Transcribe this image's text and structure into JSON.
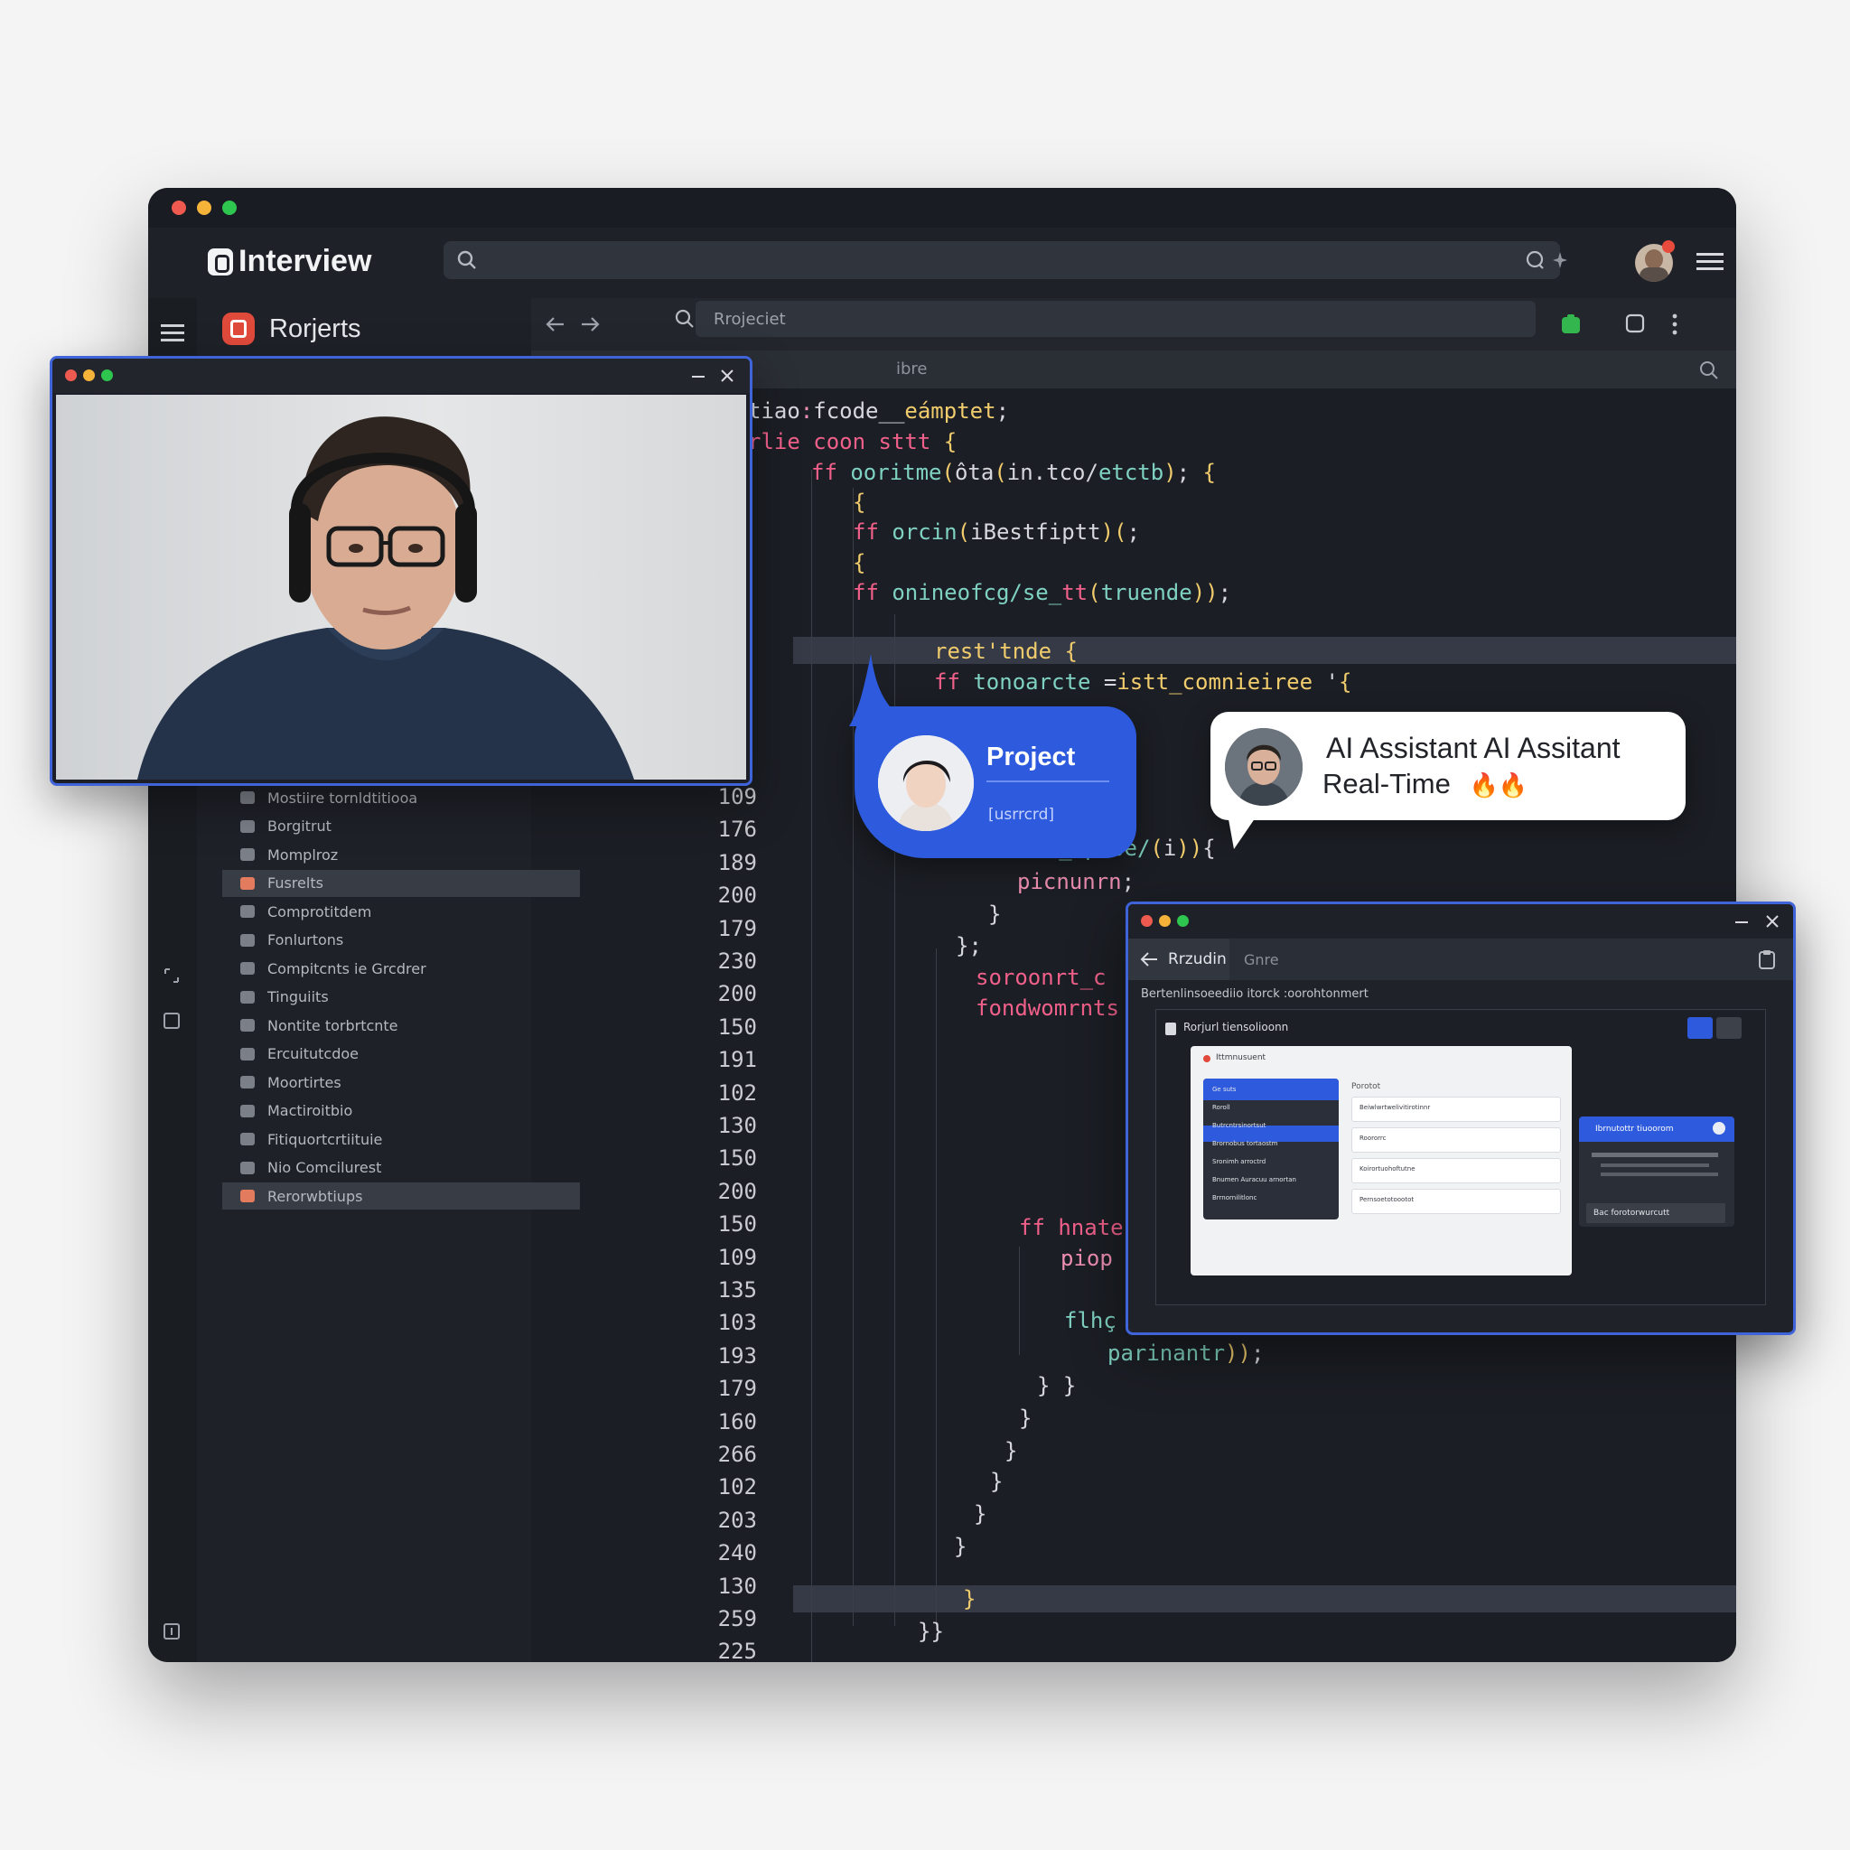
{
  "app": {
    "title": "Interview",
    "project_title": "Rorjerts"
  },
  "nav": {
    "url": "Rrojeciet",
    "subtab": "ibre"
  },
  "sidebar": {
    "items": [
      {
        "label": "Mostiire tornldtitiooa",
        "active": false
      },
      {
        "label": "Borgitrut",
        "active": false
      },
      {
        "label": "Momplroz",
        "active": false
      },
      {
        "label": "Fusrelts",
        "active": true
      },
      {
        "label": "Comprotitdem",
        "active": false
      },
      {
        "label": "Fonlurtons",
        "active": false
      },
      {
        "label": "Compitcnts ie Grcdrer",
        "active": false
      },
      {
        "label": "Tinguiits",
        "active": false
      },
      {
        "label": "Nontite torbrtcnte",
        "active": false
      },
      {
        "label": "Ercuitutcdoe",
        "active": false
      },
      {
        "label": "Moortirtes",
        "active": false
      },
      {
        "label": "Mactiroitbio",
        "active": false
      },
      {
        "label": "Fitiquortcrtiituie",
        "active": false
      },
      {
        "label": "Nio Comcilurest",
        "active": false
      },
      {
        "label": "Rerorwbtiups",
        "active": true
      }
    ]
  },
  "editor": {
    "line_numbers": [
      "109",
      "176",
      "189",
      "200",
      "179",
      "230",
      "200",
      "150",
      "191",
      "102",
      "130",
      "150",
      "200",
      "150",
      "109",
      "135",
      "103",
      "193",
      "179",
      "160",
      "266",
      "102",
      "203",
      "240",
      "130",
      "259",
      "225"
    ]
  },
  "chat": {
    "project_label": "Project",
    "project_sub": "[usrrcrd]",
    "ai_title": "AI Assistant AI Assitant",
    "ai_subtitle": "Real-Time",
    "ai_emoji": "🔥🔥"
  },
  "preview": {
    "tab_active": "Rrzudin",
    "tab_inactive": "Gnre",
    "description": "Bertenlinsoeediio itorck :oorohtonmert",
    "card_title": "Rorjurl tiensolioonn",
    "shot_title": "Ittmnusuent",
    "shot_nav": [
      "Ge suts",
      "Roroll",
      "Butrcntrsinortsut",
      "Brornobus tortaostm",
      "Sronimh arroctrd",
      "Bnumen Auracuu arnortan",
      "Brrnornilitlonc"
    ],
    "shot_panel_title": "Porotot",
    "shot_rows": [
      "Beiwlwrtwelivitirotinnr",
      "Roororrc",
      "Koirortuohoftutne",
      "Pernsoetotoootot"
    ],
    "side_card_title": "Ibrnutottr tiuoorom",
    "side_card_button": "Bac forotorwurcutt"
  },
  "colors": {
    "accent_blue": "#2e5bdd",
    "window_bg": "#1b1e24",
    "keyword_pink": "#f0608a",
    "string_teal": "#7fd2c1",
    "brace_yellow": "#f1cc6d"
  }
}
